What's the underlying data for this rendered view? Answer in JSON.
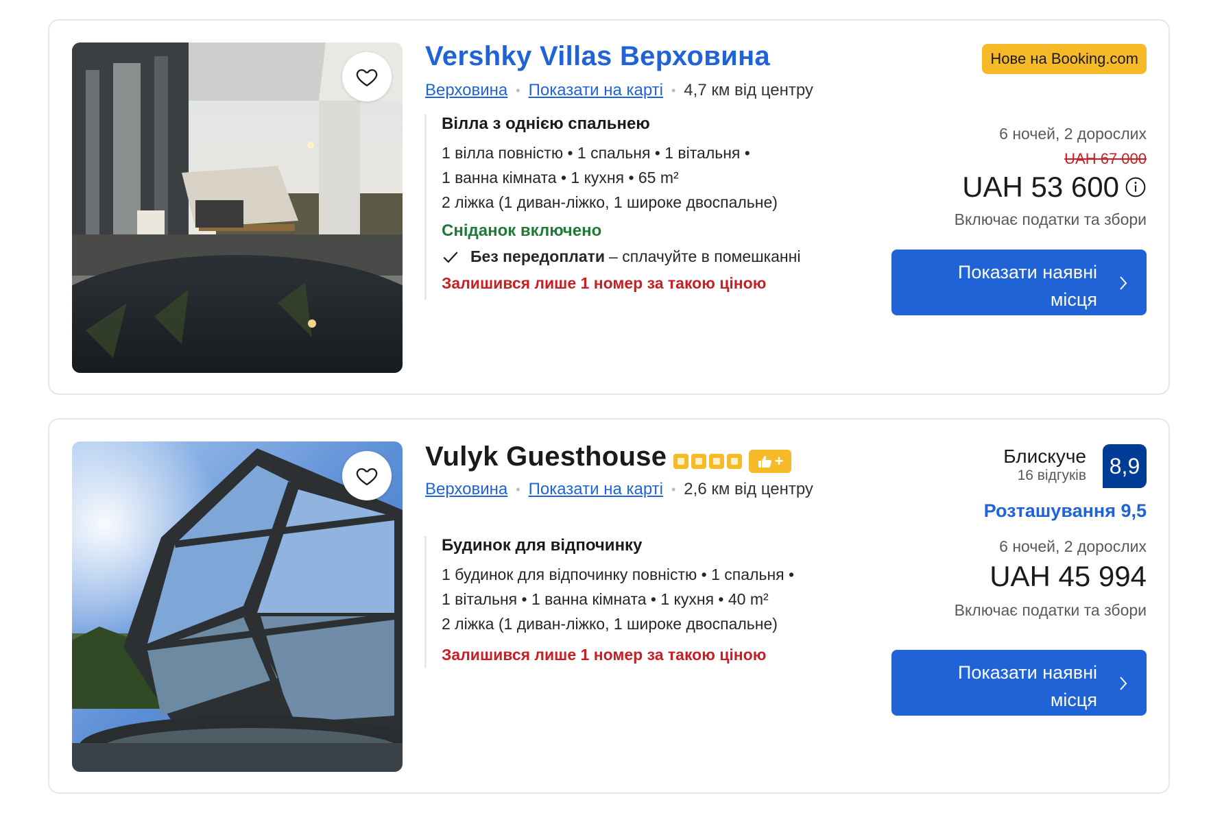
{
  "listings": [
    {
      "name": "Vershky Villas Верховина",
      "new_badge": "Нове на Booking.com",
      "city": "Верховина",
      "map_link": "Показати на карті",
      "distance": "4,7 км від центру",
      "room_type": "Вілла з однією спальнею",
      "details": [
        "1 вілла повністю • 1 спальня • 1 вітальня •",
        "1 ванна кімната • 1 кухня • 65 m²",
        "2 ліжка (1 диван-ліжко, 1 широке двоспальне)"
      ],
      "breakfast": "Сніданок включено",
      "no_prepayment_bold": "Без передоплати",
      "no_prepayment_rest": "– сплачуйте в помешканні",
      "scarcity": "Залишився лише 1 номер за такою ціною",
      "stay": "6 ночей, 2 дорослих",
      "old_price": "UAH 67 000",
      "price": "UAH 53 600",
      "taxes": "Включає податки та збори",
      "cta_line1": "Показати наявні",
      "cta_line2": "місця"
    },
    {
      "name": "Vulyk Guesthouse",
      "stars": 4,
      "preferred_icon": "thumbs-up-plus",
      "city": "Верховина",
      "map_link": "Показати на карті",
      "distance": "2,6 км від центру",
      "room_type": "Будинок для відпочинку",
      "details": [
        "1 будинок для відпочинку повністю • 1 спальня •",
        "1 вітальня • 1 ванна кімната • 1 кухня • 40 m²",
        "2 ліжка (1 диван-ліжко, 1 широке двоспальне)"
      ],
      "scarcity": "Залишився лише 1 номер за такою ціною",
      "rating_word": "Блискуче",
      "reviews": "16 відгуків",
      "score": "8,9",
      "location_score": "Розташування 9,5",
      "stay": "6 ночей, 2 дорослих",
      "price": "UAH 45 994",
      "taxes": "Включає податки та збори",
      "cta_line1": "Показати наявні",
      "cta_line2": "місця"
    }
  ],
  "colors": {
    "link_blue": "#1f63d6",
    "cta_blue": "#1f63d6",
    "score_navy": "#003b95",
    "badge_yellow": "#f6b928",
    "green": "#1f7a35",
    "red": "#c81e24"
  }
}
